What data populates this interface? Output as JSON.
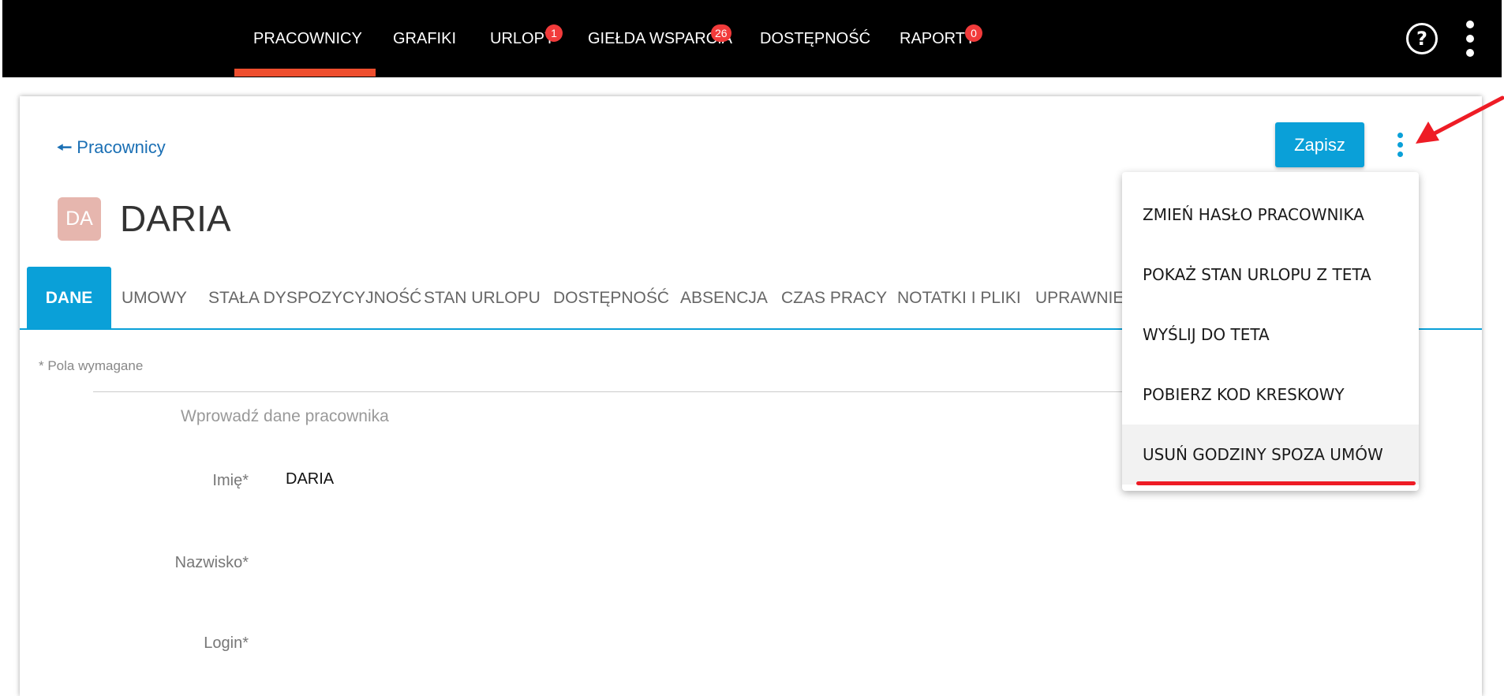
{
  "nav": {
    "items": [
      {
        "label": "PRACOWNICY",
        "badge": null,
        "active": true
      },
      {
        "label": "GRAFIKI",
        "badge": null,
        "active": false
      },
      {
        "label": "URLOPY",
        "badge": "1",
        "active": false
      },
      {
        "label": "GIEŁDA WSPARCIA",
        "badge": "26",
        "active": false
      },
      {
        "label": "DOSTĘPNOŚĆ",
        "badge": null,
        "active": false
      },
      {
        "label": "RAPORTY",
        "badge": "0",
        "active": false
      }
    ],
    "help_icon": "question-mark-circle-icon",
    "menu_icon": "kebab-vertical-icon",
    "active_color": "#ee4e2e",
    "badge_color": "#f23b3b"
  },
  "header": {
    "back_label": "Pracownicy",
    "back_icon": "arrow-left-icon",
    "save_label": "Zapisz",
    "more_icon": "kebab-vertical-icon",
    "avatar_initials": "DA",
    "employee_name": "DARIA",
    "accent_color": "#0aa0d8"
  },
  "tabs": [
    {
      "label": "DANE",
      "active": true
    },
    {
      "label": "UMOWY",
      "active": false
    },
    {
      "label": "STAŁA DYSPOZYCYJNOŚĆ",
      "active": false
    },
    {
      "label": "STAN URLOPU",
      "active": false
    },
    {
      "label": "DOSTĘPNOŚĆ",
      "active": false
    },
    {
      "label": "ABSENCJA",
      "active": false
    },
    {
      "label": "CZAS PRACY",
      "active": false
    },
    {
      "label": "NOTATKI I PLIKI",
      "active": false
    },
    {
      "label": "UPRAWNIE",
      "active": false
    }
  ],
  "form": {
    "required_note": "* Pola wymagane",
    "section_title": "Wprowadź dane pracownika",
    "fields": [
      {
        "label": "Imię*",
        "value": "DARIA"
      },
      {
        "label": "Nazwisko*",
        "value": ""
      },
      {
        "label": "Login*",
        "value": ""
      }
    ]
  },
  "dropdown": {
    "items": [
      {
        "label": "ZMIEŃ HASŁO PRACOWNIKA"
      },
      {
        "label": "POKAŻ STAN URLOPU Z TETA"
      },
      {
        "label": "WYŚLIJ DO TETA"
      },
      {
        "label": "POBIERZ KOD KRESKOWY"
      },
      {
        "label": "USUŃ GODZINY SPOZA UMÓW",
        "highlighted": true
      }
    ]
  },
  "annotation": {
    "arrow_color": "#ee1c25",
    "arrow_icon": "red-arrow-pointer-icon"
  }
}
